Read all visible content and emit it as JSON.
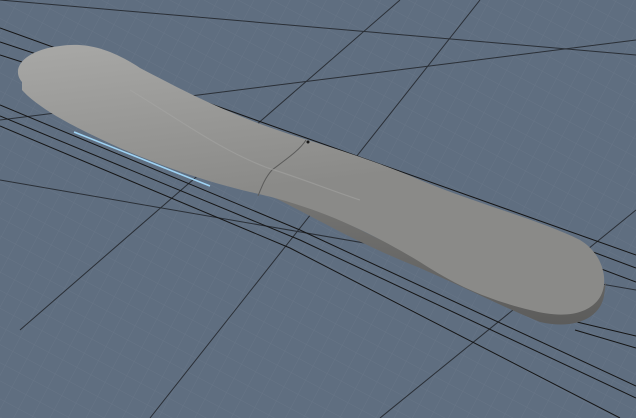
{
  "viewport": {
    "type": "3d-perspective-view",
    "background_color": "#5f6e80",
    "grid": {
      "visible": true,
      "minor_color": "#6d7a8b",
      "major_color": "#2a2f36"
    },
    "selection_edge_color": "#9fd3f4"
  },
  "model": {
    "shape": "elongated-paddle",
    "surface_color": "#8a8a88",
    "highlight_color": "#a8a8a6",
    "shadow_color": "#5c5c5b",
    "wireframe_color": "#151515"
  }
}
